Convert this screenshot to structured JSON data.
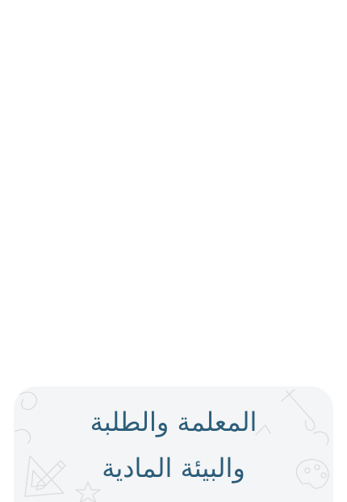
{
  "card": {
    "title_lines": [
      "المعلمة والطلبة",
      "والبيئة المادية"
    ],
    "colors": {
      "background": "#f4f5f6",
      "title": "#2c5d7a",
      "doodle_stroke": "#d9dcdf"
    },
    "background_pattern_icons": [
      "pencil-icon",
      "paint-brush-icon",
      "triangle-ruler-icon",
      "star-icon",
      "palette-icon",
      "swirl-icon"
    ]
  }
}
